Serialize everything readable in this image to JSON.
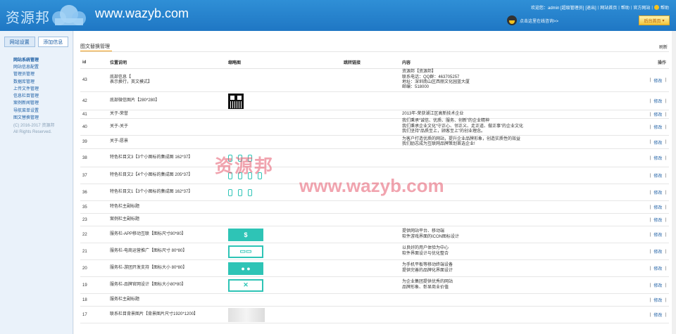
{
  "header": {
    "logo_text": "资源邦",
    "site_url": "www.wazyb.com",
    "welcome": "欢迎您：admin [超级管理员]",
    "links": [
      "[退出]",
      "网站首页",
      "帮助",
      "官方网站",
      "帮助"
    ],
    "qq_text": "点击这里在线咨询>>",
    "home_button": "后台首页"
  },
  "sidebar": {
    "tabs": [
      "网站设置",
      "添加信息"
    ],
    "menu_head": "网站系统管理",
    "items": [
      "网站信息配置",
      "管理员管理",
      "数据库管理",
      "上传文件管理",
      "信息栏目管理",
      "案例新闻管理",
      "导航菜单设置",
      "图文替换管理"
    ],
    "copyright": [
      "(C) 2016-2017 资源邦",
      "All Rights Reserved."
    ]
  },
  "main": {
    "title": "图文替换管理",
    "refresh": "刷新",
    "columns": {
      "id": "id",
      "pos": "位置说明",
      "img": "缩略图",
      "link": "跳转链接",
      "content": "内容",
      "op": "操作"
    },
    "op_edit": "修改",
    "rows": [
      {
        "id": "43",
        "pos": [
          "底部信息【",
          "表示换行，英文模式】"
        ],
        "content": [
          "资源邦【资源邦】",
          "联系电话：QQ群：463705257",
          "地址：深圳南山区西丽文化园蓝大厦",
          "邮编：518000"
        ]
      },
      {
        "id": "42",
        "pos": [
          "底部微信图片【280*280】"
        ],
        "content": []
      },
      {
        "id": "41",
        "pos": [
          "关于-荣誉"
        ],
        "content": [
          "2013年-荣获湖江区高新技术企业"
        ]
      },
      {
        "id": "40",
        "pos": [
          "关于-关于"
        ],
        "content": [
          "我们秉承“诚信、优质、服务、创新”的企业精神",
          "我们秉承企业文化“守正心、邻正义、走正道、做正事”的企业文化",
          "我们坚持“品质至上，顾客至上”的创业理念。"
        ]
      },
      {
        "id": "39",
        "pos": [
          "关于-愿景"
        ],
        "content": [
          "为客户打造优质的网站，提升企业品牌形象，创造实质性的效益",
          "我们励志成为互联网品牌策划首选企业!"
        ]
      },
      {
        "id": "38",
        "pos": [
          "特色栏目文3【3个小图标的集成图 162*37】"
        ],
        "content": []
      },
      {
        "id": "37",
        "pos": [
          "特色栏目文2【4个小图标的集成图 205*37】"
        ],
        "content": []
      },
      {
        "id": "36",
        "pos": [
          "特色栏目文1【3个小图标的集成图 162*37】"
        ],
        "content": []
      },
      {
        "id": "35",
        "pos": [
          "特色栏主副标题"
        ],
        "content": []
      },
      {
        "id": "23",
        "pos": [
          "案例栏主副标题"
        ],
        "content": []
      },
      {
        "id": "22",
        "pos": [
          "服务栏-APP移动互联【图标尺寸80*80】"
        ],
        "content": [
          "提供网站平台、移动端",
          "软件游戏界面的ICON图标设计"
        ]
      },
      {
        "id": "21",
        "pos": [
          "服务栏-电商运营推广【图标尺寸 80*80】"
        ],
        "content": [
          "以良好的用户体验为中心",
          "软件界面设计与优化整合"
        ]
      },
      {
        "id": "20",
        "pos": [
          "服务栏-游团开发支持【图标大小 80*80】"
        ],
        "content": [
          "为手机平板等移动终端设备",
          "提供完善的品牌化界面设计"
        ]
      },
      {
        "id": "19",
        "pos": [
          "服务栏-品牌官网设计【图标大小80*80】"
        ],
        "content": [
          "为企业集团提供优秀的网站",
          "品牌形象、彰显商业价值"
        ]
      },
      {
        "id": "18",
        "pos": [
          "服务栏主副标题"
        ],
        "content": []
      },
      {
        "id": "17",
        "pos": [
          "联系栏目背景图片【背景图片尺寸1920*1200】"
        ],
        "content": []
      }
    ]
  },
  "watermark": {
    "cn": "资源邦",
    "url": "www.wazyb.com"
  },
  "colors": {
    "header_blue": "#1f77c4",
    "accent_orange": "#f39c12",
    "icon_teal": "#2ec4b6",
    "link_blue": "#1d5fa5"
  }
}
